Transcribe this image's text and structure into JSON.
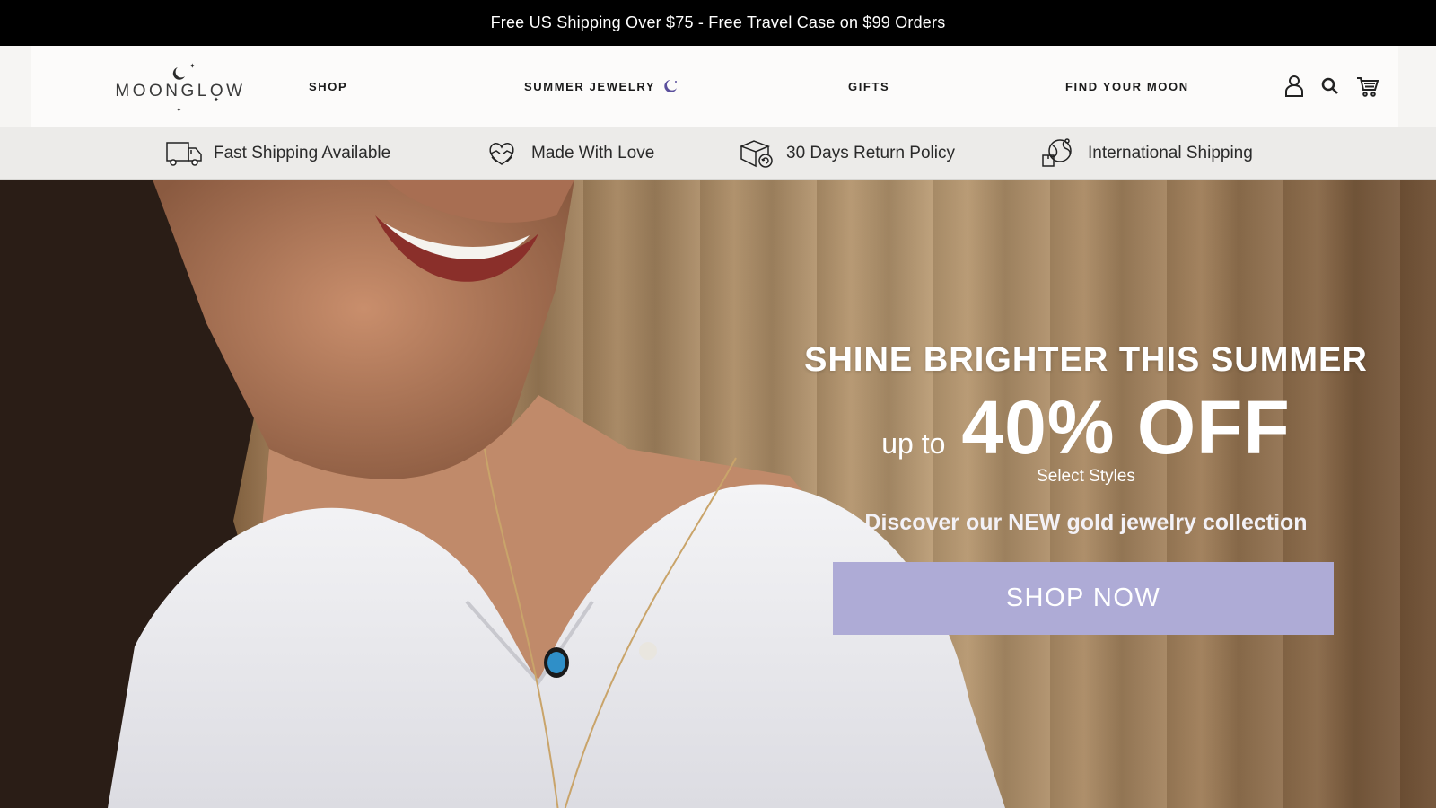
{
  "announcement": {
    "text": "Free US Shipping Over $75 - Free Travel Case on $99 Orders"
  },
  "header": {
    "logo_text": "MOONGLOW",
    "nav": [
      {
        "label": "SHOP"
      },
      {
        "label": "SUMMER JEWELRY",
        "icon": "crescent-moon-icon"
      },
      {
        "label": "GIFTS"
      },
      {
        "label": "FIND YOUR MOON"
      }
    ],
    "icons": [
      "account-icon",
      "search-icon",
      "cart-icon"
    ]
  },
  "features": [
    {
      "label": "Fast Shipping Available",
      "icon": "truck-icon"
    },
    {
      "label": "Made With Love",
      "icon": "heart-hands-icon"
    },
    {
      "label": "30 Days Return Policy",
      "icon": "box-return-icon"
    },
    {
      "label": "International Shipping",
      "icon": "globe-package-icon"
    }
  ],
  "hero": {
    "headline": "SHINE BRIGHTER THIS SUMMER",
    "up_to": "up to",
    "discount": "40% OFF",
    "sub": "Select Styles",
    "discover": "Discover our NEW gold jewelry collection",
    "cta": "SHOP NOW"
  },
  "colors": {
    "announcement_bg": "#000000",
    "accent_lavender": "#aeabd6",
    "moon_icon": "#5a4f9c"
  }
}
